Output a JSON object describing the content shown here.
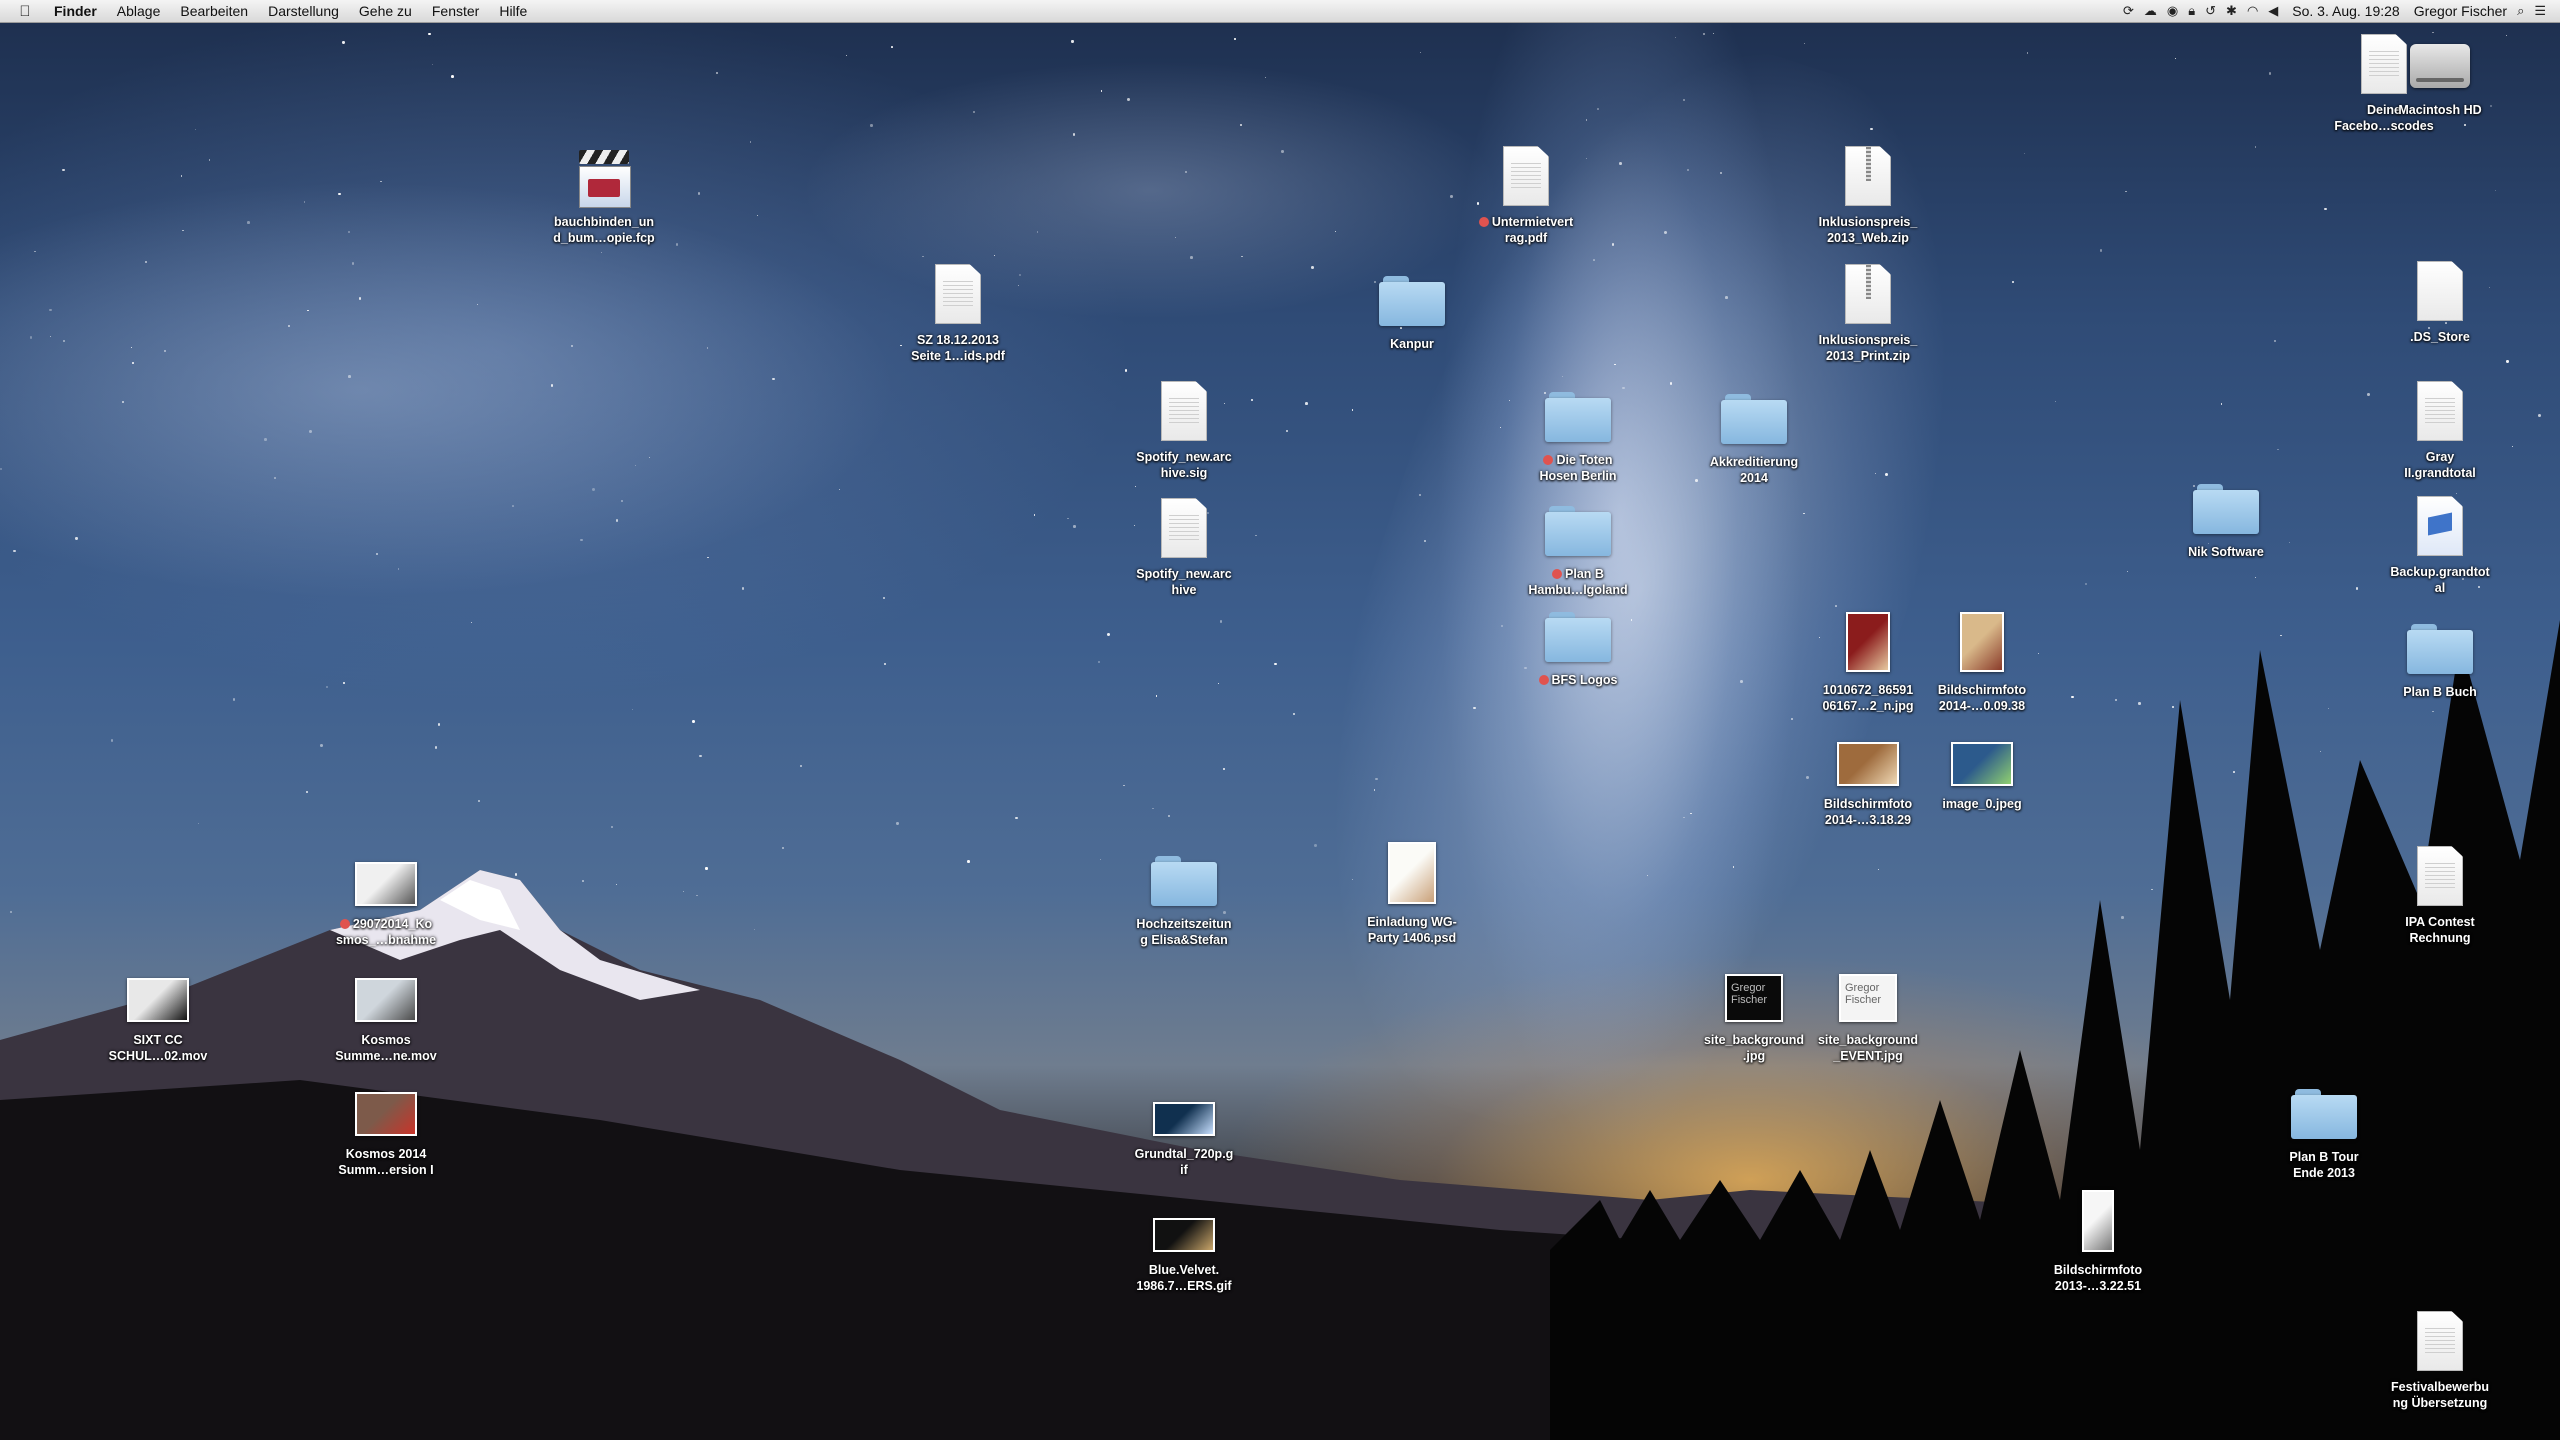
{
  "menubar": {
    "apple_icon": "apple-logo-icon",
    "items": [
      "Finder",
      "Ablage",
      "Bearbeiten",
      "Darstellung",
      "Gehe zu",
      "Fenster",
      "Hilfe"
    ],
    "status_icons": [
      "sync-icon",
      "cloud-icon",
      "drive-icon",
      "lock-icon",
      "time-machine-icon",
      "bluetooth-icon",
      "wifi-icon",
      "volume-icon"
    ],
    "clock": "So. 3. Aug.  19:28",
    "user": "Gregor Fischer",
    "search_icon": "spotlight-icon",
    "notification_icon": "notification-center-icon"
  },
  "desktop": {
    "icons": [
      {
        "id": "deine-facebook",
        "label": "Deine\nFacebo…scodes",
        "kind": "pdf",
        "tag": false
      },
      {
        "id": "macintosh-hd",
        "label": "Macintosh HD",
        "kind": "hdd",
        "tag": false
      },
      {
        "id": "bauchbinden",
        "label": "bauchbinden_un\nd_bum…opie.fcp",
        "kind": "fcp",
        "tag": false
      },
      {
        "id": "untermietvertrag",
        "label": "Untermietvert\nrag.pdf",
        "kind": "pdf",
        "tag": true
      },
      {
        "id": "inklusionspreis-web",
        "label": "Inklusionspreis_\n2013_Web.zip",
        "kind": "zip",
        "tag": false
      },
      {
        "id": "sz-18122013",
        "label": "SZ 18.12.2013\nSeite 1…ids.pdf",
        "kind": "pdf",
        "tag": false
      },
      {
        "id": "kanpur",
        "label": "Kanpur",
        "kind": "folder",
        "tag": false
      },
      {
        "id": "inklusionspreis-print",
        "label": "Inklusionspreis_\n2013_Print.zip",
        "kind": "zip",
        "tag": false
      },
      {
        "id": "ds-store",
        "label": ".DS_Store",
        "kind": "blank",
        "tag": false
      },
      {
        "id": "spotify-sig",
        "label": "Spotify_new.arc\nhive.sig",
        "kind": "rtf",
        "tag": false
      },
      {
        "id": "die-toten-hosen",
        "label": "Die Toten\nHosen Berlin",
        "kind": "folder",
        "tag": true
      },
      {
        "id": "akkreditierung",
        "label": "Akkreditierung\n2014",
        "kind": "folder",
        "tag": false
      },
      {
        "id": "gray-grandtotal",
        "label": "Gray\nII.grandtotal",
        "kind": "doc",
        "tag": false
      },
      {
        "id": "nik-software",
        "label": "Nik Software",
        "kind": "folder",
        "tag": false
      },
      {
        "id": "spotify-archive",
        "label": "Spotify_new.arc\nhive",
        "kind": "rtf",
        "tag": false
      },
      {
        "id": "plan-b-hamburg",
        "label": "Plan B\nHambu…lgoland",
        "kind": "folder",
        "tag": true
      },
      {
        "id": "backup-grandtotal",
        "label": "Backup.grandtot\nal",
        "kind": "backup",
        "tag": false
      },
      {
        "id": "bfs-logos",
        "label": "BFS Logos",
        "kind": "folder",
        "tag": true
      },
      {
        "id": "img-1010672",
        "label": "1010672_86591\n06167…2_n.jpg",
        "kind": "image",
        "tag": false
      },
      {
        "id": "bildschirmfoto-0938",
        "label": "Bildschirmfoto\n2014-…0.09.38",
        "kind": "image",
        "tag": false
      },
      {
        "id": "plan-b-buch",
        "label": "Plan B Buch",
        "kind": "folder",
        "tag": false
      },
      {
        "id": "bildschirmfoto-31829",
        "label": "Bildschirmfoto\n2014-…3.18.29",
        "kind": "image",
        "tag": false
      },
      {
        "id": "image-0",
        "label": "image_0.jpeg",
        "kind": "image",
        "tag": false
      },
      {
        "id": "kosmos-29072014",
        "label": "29072014_Ko\nsmos_…bnahme",
        "kind": "video",
        "tag": true
      },
      {
        "id": "hochzeitszeitung",
        "label": "Hochzeitszeitun\ng Elisa&Stefan",
        "kind": "folder",
        "tag": false
      },
      {
        "id": "einladung-wg",
        "label": "Einladung WG-\nParty 1406.psd",
        "kind": "psd",
        "tag": false
      },
      {
        "id": "ipa-contest",
        "label": "IPA Contest\nRechnung",
        "kind": "pdf",
        "tag": false
      },
      {
        "id": "sixt-cc",
        "label": "SIXT CC\nSCHUL…02.mov",
        "kind": "video",
        "tag": false
      },
      {
        "id": "kosmos-summe",
        "label": "Kosmos\nSumme…ne.mov",
        "kind": "video",
        "tag": false
      },
      {
        "id": "site-background",
        "label": "site_background\n.jpg",
        "kind": "logo-dark",
        "tag": false
      },
      {
        "id": "site-background-event",
        "label": "site_background\n_EVENT.jpg",
        "kind": "logo-light",
        "tag": false
      },
      {
        "id": "kosmos-2014",
        "label": "Kosmos 2014\nSumm…ersion I",
        "kind": "video",
        "tag": false
      },
      {
        "id": "grundtal",
        "label": "Grundtal_720p.g\nif",
        "kind": "image",
        "tag": false
      },
      {
        "id": "plan-b-tour",
        "label": "Plan B Tour\nEnde 2013",
        "kind": "folder",
        "tag": false
      },
      {
        "id": "blue-velvet",
        "label": "Blue.Velvet.\n1986.7…ERS.gif",
        "kind": "image",
        "tag": false
      },
      {
        "id": "bildschirmfoto-2013",
        "label": "Bildschirmfoto\n2013-…3.22.51",
        "kind": "portrait",
        "tag": false
      },
      {
        "id": "festivalbewerbung",
        "label": "Festivalbewerbu\nng Übersetzung",
        "kind": "rtf",
        "tag": false
      }
    ],
    "logo_text": "Gregor\nFischer"
  }
}
